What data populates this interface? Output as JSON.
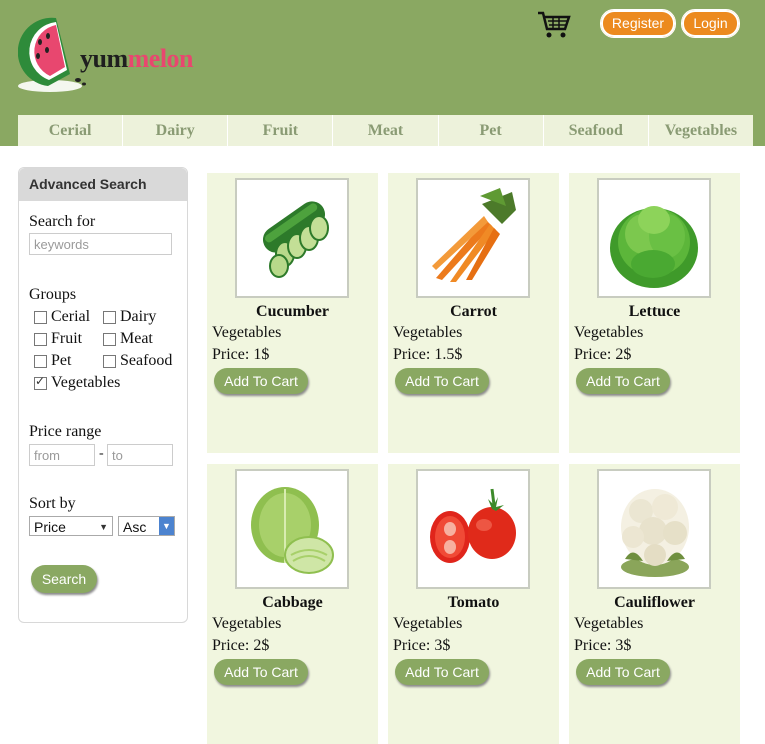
{
  "header": {
    "logo_yum": "yum",
    "logo_melon": "melon",
    "register_label": "Register",
    "login_label": "Login"
  },
  "nav": [
    "Cerial",
    "Dairy",
    "Fruit",
    "Meat",
    "Pet",
    "Seafood",
    "Vegetables"
  ],
  "sidebar": {
    "title": "Advanced Search",
    "search_label": "Search for",
    "search_placeholder": "keywords",
    "groups_label": "Groups",
    "groups": [
      {
        "label": "Cerial",
        "checked": false
      },
      {
        "label": "Dairy",
        "checked": false
      },
      {
        "label": "Fruit",
        "checked": false
      },
      {
        "label": "Meat",
        "checked": false
      },
      {
        "label": "Pet",
        "checked": false
      },
      {
        "label": "Seafood",
        "checked": false
      },
      {
        "label": "Vegetables",
        "checked": true
      }
    ],
    "price_label": "Price range",
    "from_placeholder": "from",
    "to_placeholder": "to",
    "dash": "-",
    "sort_label": "Sort by",
    "sort_field": "Price",
    "sort_order": "Asc",
    "search_button": "Search"
  },
  "products": [
    {
      "name": "Cucumber",
      "category": "Vegetables",
      "price_label": "Price: ",
      "price": "1$",
      "button": "Add To Cart",
      "icon": "cucumber-image"
    },
    {
      "name": "Carrot",
      "category": "Vegetables",
      "price_label": "Price: ",
      "price": "1.5$",
      "button": "Add To Cart",
      "icon": "carrot-image"
    },
    {
      "name": "Lettuce",
      "category": "Vegetables",
      "price_label": "Price: ",
      "price": "2$",
      "button": "Add To Cart",
      "icon": "lettuce-image"
    },
    {
      "name": "Cabbage",
      "category": "Vegetables",
      "price_label": "Price: ",
      "price": "2$",
      "button": "Add To Cart",
      "icon": "cabbage-image"
    },
    {
      "name": "Tomato",
      "category": "Vegetables",
      "price_label": "Price: ",
      "price": "3$",
      "button": "Add To Cart",
      "icon": "tomato-image"
    },
    {
      "name": "Cauliflower",
      "category": "Vegetables",
      "price_label": "Price: ",
      "price": "3$",
      "button": "Add To Cart",
      "icon": "cauliflower-image"
    }
  ],
  "colors": {
    "header_green": "#8aa862",
    "accent_orange": "#ec8a1f",
    "card_bg": "#f1f6df"
  }
}
